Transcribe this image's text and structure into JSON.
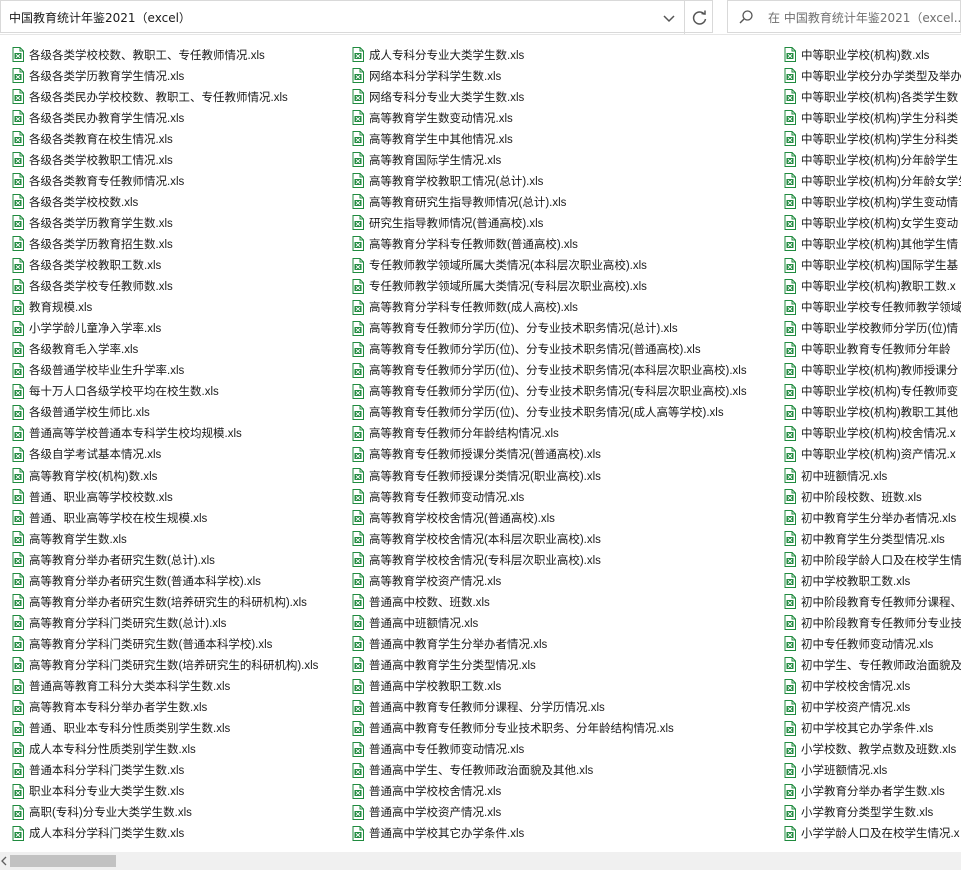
{
  "address": {
    "path": "中国教育统计年鉴2021（excel）"
  },
  "search": {
    "placeholder": "在 中国教育统计年鉴2021（excel..."
  },
  "colors": {
    "file_icon_green": "#1f8a3e",
    "text": "#1a1a1a"
  },
  "columns": [
    {
      "files": [
        "各级各类学校校数、教职工、专任教师情况.xls",
        "各级各类学历教育学生情况.xls",
        "各级各类民办学校校数、教职工、专任教师情况.xls",
        "各级各类民办教育学生情况.xls",
        "各级各类教育在校生情况.xls",
        "各级各类学校教职工情况.xls",
        "各级各类教育专任教师情况.xls",
        "各级各类学校校数.xls",
        "各级各类学历教育学生数.xls",
        "各级各类学历教育招生数.xls",
        "各级各类学校教职工数.xls",
        "各级各类学校专任教师数.xls",
        "教育规模.xls",
        "小学学龄儿童净入学率.xls",
        "各级教育毛入学率.xls",
        "各级普通学校毕业生升学率.xls",
        "每十万人口各级学校平均在校生数.xls",
        "各级普通学校生师比.xls",
        "普通高等学校普通本专科学生校均规模.xls",
        "各级自学考试基本情况.xls",
        "高等教育学校(机构)数.xls",
        "普通、职业高等学校校数.xls",
        "普通、职业高等学校在校生规模.xls",
        "高等教育学生数.xls",
        "高等教育分举办者研究生数(总计).xls",
        "高等教育分举办者研究生数(普通本科学校).xls",
        "高等教育分举办者研究生数(培养研究生的科研机构).xls",
        "高等教育分学科门类研究生数(总计).xls",
        "高等教育分学科门类研究生数(普通本科学校).xls",
        "高等教育分学科门类研究生数(培养研究生的科研机构).xls",
        "普通高等教育工科分大类本科学生数.xls",
        "高等教育本专科分举办者学生数.xls",
        "普通、职业本专科分性质类别学生数.xls",
        "成人本专科分性质类别学生数.xls",
        "普通本科分学科门类学生数.xls",
        "职业本科分专业大类学生数.xls",
        "高职(专科)分专业大类学生数.xls",
        "成人本科分学科门类学生数.xls"
      ]
    },
    {
      "files": [
        "成人专科分专业大类学生数.xls",
        "网络本科分学科学生数.xls",
        "网络专科分专业大类学生数.xls",
        "高等教育学生数变动情况.xls",
        "高等教育学生中其他情况.xls",
        "高等教育国际学生情况.xls",
        "高等教育学校教职工情况(总计).xls",
        "高等教育研究生指导教师情况(总计).xls",
        "研究生指导教师情况(普通高校).xls",
        "高等教育分学科专任教师数(普通高校).xls",
        "专任教师教学领域所属大类情况(本科层次职业高校).xls",
        "专任教师教学领域所属大类情况(专科层次职业高校).xls",
        "高等教育分学科专任教师数(成人高校).xls",
        "高等教育专任教师分学历(位)、分专业技术职务情况(总计).xls",
        "高等教育专任教师分学历(位)、分专业技术职务情况(普通高校).xls",
        "高等教育专任教师分学历(位)、分专业技术职务情况(本科层次职业高校).xls",
        "高等教育专任教师分学历(位)、分专业技术职务情况(专科层次职业高校).xls",
        "高等教育专任教师分学历(位)、分专业技术职务情况(成人高等学校).xls",
        "高等教育专任教师分年龄结构情况.xls",
        "高等教育专任教师授课分类情况(普通高校).xls",
        "高等教育专任教师授课分类情况(职业高校).xls",
        "高等教育专任教师变动情况.xls",
        "高等教育学校校舍情况(普通高校).xls",
        "高等教育学校校舍情况(本科层次职业高校).xls",
        "高等教育学校校舍情况(专科层次职业高校).xls",
        "高等教育学校资产情况.xls",
        "普通高中校数、班数.xls",
        "普通高中班额情况.xls",
        "普通高中教育学生分举办者情况.xls",
        "普通高中教育学生分类型情况.xls",
        "普通高中学校教职工数.xls",
        "普通高中教育专任教师分课程、分学历情况.xls",
        "普通高中教育专任教师分专业技术职务、分年龄结构情况.xls",
        "普通高中专任教师变动情况.xls",
        "普通高中学生、专任教师政治面貌及其他.xls",
        "普通高中学校校舍情况.xls",
        "普通高中学校资产情况.xls",
        "普通高中学校其它办学条件.xls"
      ]
    },
    {
      "files": [
        "中等职业学校(机构)数.xls",
        "中等职业学校分办学类型及举办",
        "中等职业学校(机构)各类学生数",
        "中等职业学校(机构)学生分科类",
        "中等职业学校(机构)学生分科类",
        "中等职业学校(机构)分年龄学生",
        "中等职业学校(机构)分年龄女学生",
        "中等职业学校(机构)学生变动情",
        "中等职业学校(机构)女学生变动",
        "中等职业学校(机构)其他学生情",
        "中等职业学校(机构)国际学生基",
        "中等职业学校(机构)教职工数.x",
        "中等职业学校专任教师教学领域",
        "中等职业学校教师分学历(位)情",
        "中等职业教育专任教师分年龄",
        "中等职业学校(机构)教师授课分",
        "中等职业学校(机构)专任教师变",
        "中等职业学校(机构)教职工其他",
        "中等职业学校(机构)校舍情况.x",
        "中等职业学校(机构)资产情况.x",
        "初中班额情况.xls",
        "初中阶段校数、班数.xls",
        "初中教育学生分举办者情况.xls",
        "初中教育学生分类型情况.xls",
        "初中阶段学龄人口及在校学生情",
        "初中学校教职工数.xls",
        "初中阶段教育专任教师分课程、",
        "初中阶段教育专任教师分专业技",
        "初中专任教师变动情况.xls",
        "初中学生、专任教师政治面貌及",
        "初中学校校舍情况.xls",
        "初中学校资产情况.xls",
        "初中学校其它办学条件.xls",
        "小学校数、教学点数及班数.xls",
        "小学班额情况.xls",
        "小学教育分举办者学生数.xls",
        "小学教育分类型学生数.xls",
        "小学学龄人口及在校学生情况.x"
      ]
    }
  ]
}
